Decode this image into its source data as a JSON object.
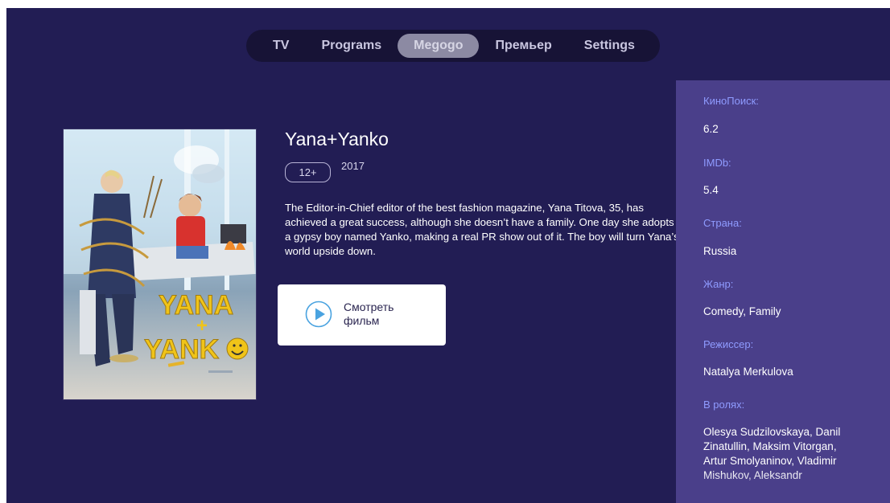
{
  "nav": {
    "items": [
      {
        "label": "TV"
      },
      {
        "label": "Programs"
      },
      {
        "label": "Megogo",
        "active": true
      },
      {
        "label": "Премьер"
      },
      {
        "label": "Settings"
      }
    ]
  },
  "poster": {
    "line1": "YANA",
    "line2": "+",
    "line3": "YANK",
    "smiley": "☺"
  },
  "movie": {
    "title": "Yana+Yanko",
    "age_rating": "12+",
    "year": "2017",
    "description": "The Editor-in-Chief editor of the best fashion magazine, Yana Titova, 35, has achieved a great success, although she doesn’t have a family. One day she adopts a gypsy boy named Yanko, making a real PR show out of it. The boy will turn Yana’s world upside down.",
    "watch_button": "Смотреть фильм"
  },
  "details": {
    "kinopoisk_label": "КиноПоиск:",
    "kinopoisk_value": "6.2",
    "imdb_label": "IMDb:",
    "imdb_value": "5.4",
    "country_label": "Страна:",
    "country_value": "Russia",
    "genre_label": "Жанр:",
    "genre_value": "Comedy, Family",
    "director_label": "Режиссер:",
    "director_value": "Natalya Merkulova",
    "cast_label": "В ролях:",
    "cast_value": "Olesya Sudzilovskaya, Danil Zinatullin, Maksim Vitorgan, Artur Smolyaninov, Vladimir Mishukov, Aleksandr"
  },
  "colors": {
    "background": "#221d54",
    "nav_bar": "#171336",
    "nav_active": "#8c8aa3",
    "side_panel": "#4a3f8a",
    "label_accent": "#8f9bff",
    "play_icon": "#4aa3e0"
  }
}
